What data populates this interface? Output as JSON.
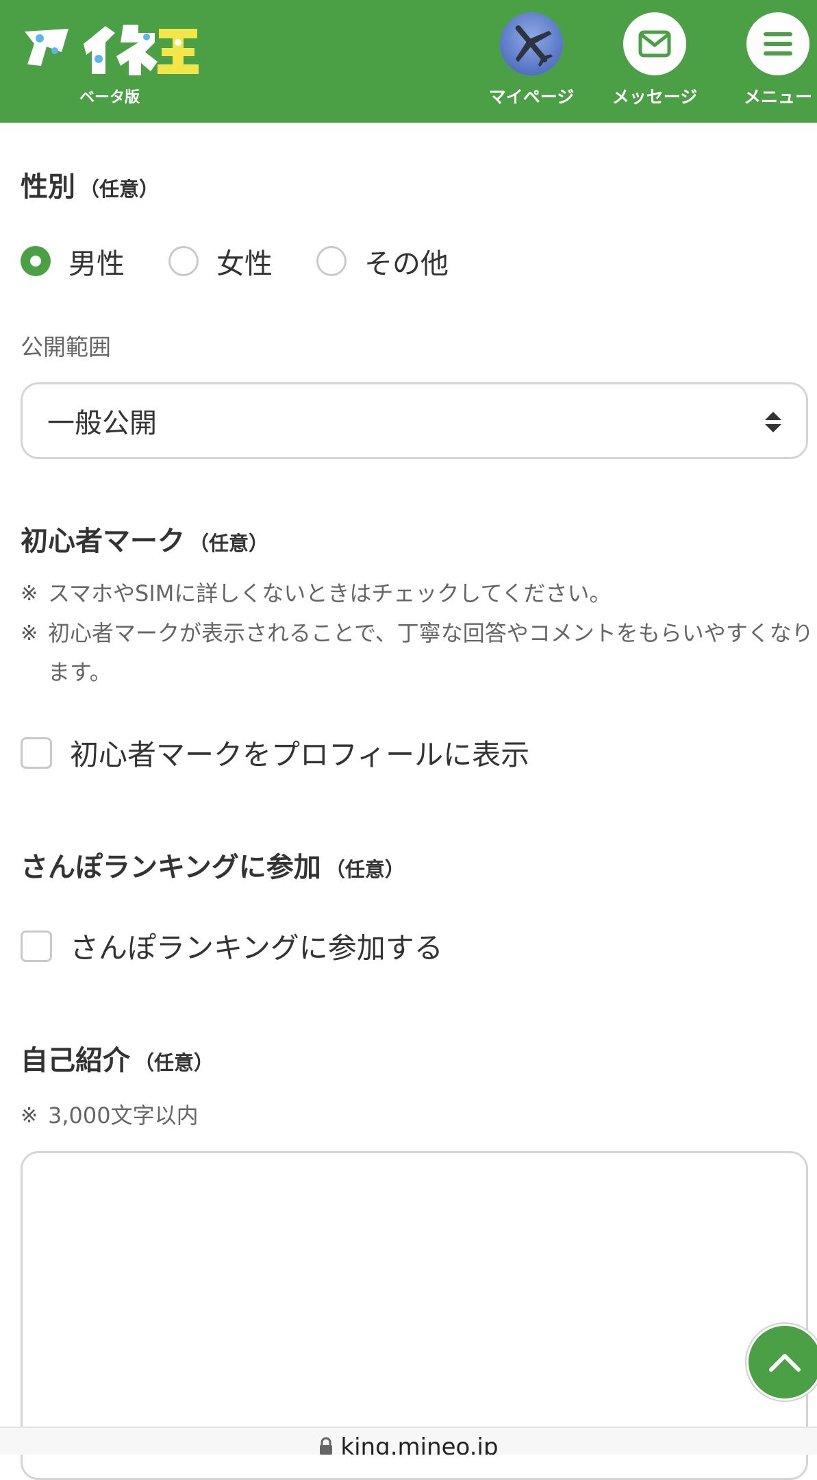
{
  "header": {
    "logo_text": "マイネ王",
    "logo_sub": "ベータ版",
    "nav": [
      {
        "label": "マイページ"
      },
      {
        "label": "メッセージ"
      },
      {
        "label": "メニュー"
      }
    ]
  },
  "gender": {
    "title": "性別",
    "optional": "（任意）",
    "options": [
      "男性",
      "女性",
      "その他"
    ],
    "selected": "男性",
    "visibility_label": "公開範囲",
    "visibility_value": "一般公開"
  },
  "beginner": {
    "title": "初心者マーク",
    "optional": "（任意）",
    "notes": [
      "スマホやSIMに詳しくないときはチェックしてください。",
      "初心者マークが表示されることで、丁寧な回答やコメントをもらいやすくなります。"
    ],
    "note_mark": "※",
    "checkbox_label": "初心者マークをプロフィールに表示",
    "checked": false
  },
  "sanpo": {
    "title": "さんぽランキングに参加",
    "optional": "（任意）",
    "checkbox_label": "さんぽランキングに参加する",
    "checked": false
  },
  "intro": {
    "title": "自己紹介",
    "optional": "（任意）",
    "note_mark": "※",
    "note": "3,000文字以内",
    "value": ""
  },
  "browser": {
    "url": "king.mineo.jp"
  },
  "colors": {
    "brand_green": "#4b9f45",
    "logo_blue": "#5bb7e8",
    "logo_yellow": "#f3e64a"
  }
}
